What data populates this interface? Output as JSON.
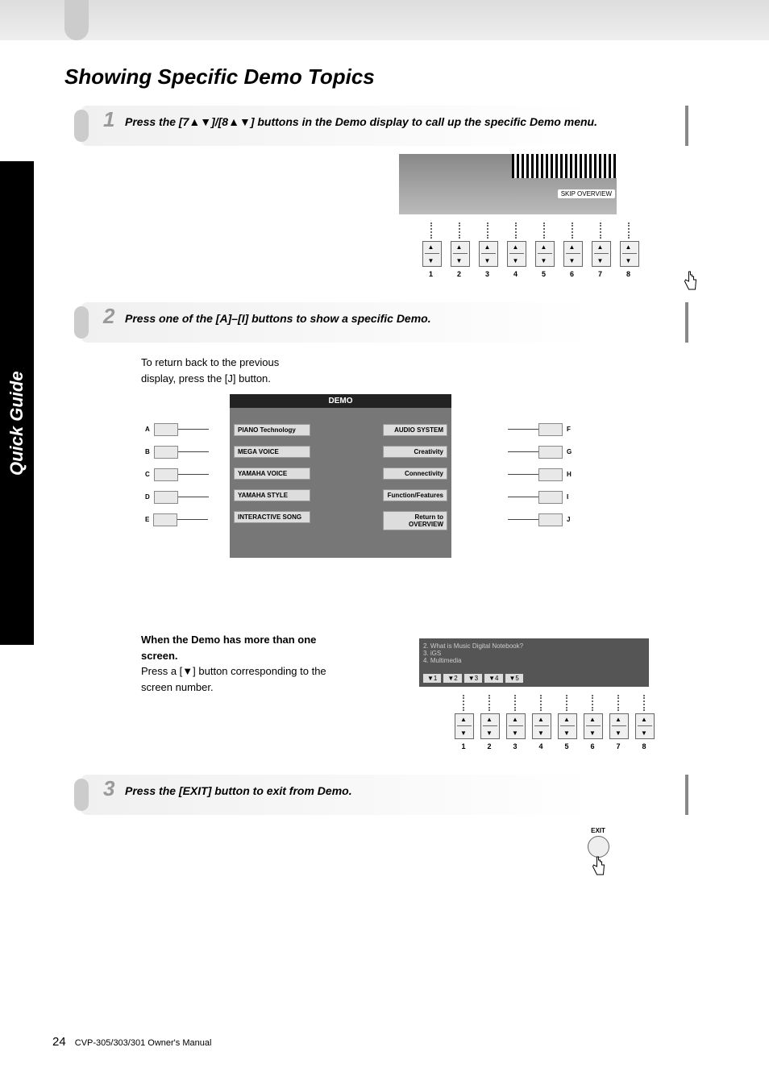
{
  "side_tab": "Quick Guide",
  "title": "Showing Specific Demo Topics",
  "step1": {
    "num": "1",
    "text_prefix": "Press the [7",
    "text_mid": "]/[8",
    "text_suffix": "] buttons in the Demo display to call up the specific Demo menu.",
    "skip_overview": "SKIP OVERVIEW",
    "buttons": [
      "1",
      "2",
      "3",
      "4",
      "5",
      "6",
      "7",
      "8"
    ]
  },
  "step2": {
    "num": "2",
    "text": "Press one of the [A]–[I] buttons to show a specific Demo.",
    "sub": "To return back to the previous display, press the [J] button.",
    "lcd_title": "DEMO",
    "left_labels": [
      "A",
      "B",
      "C",
      "D",
      "E"
    ],
    "right_labels": [
      "F",
      "G",
      "H",
      "I",
      "J"
    ],
    "menu_left": [
      "PIANO Technology",
      "MEGA VOICE",
      "YAMAHA VOICE",
      "YAMAHA STYLE",
      "INTERACTIVE SONG"
    ],
    "menu_right": [
      "AUDIO SYSTEM",
      "Creativity",
      "Connectivity",
      "Function/Features",
      "Return to OVERVIEW"
    ]
  },
  "multiscreen": {
    "heading": "When the Demo has more than one screen.",
    "sub": "Press a [▼] button corresponding to the screen number.",
    "lcd_lines": [
      "2. What is Music Digital Notebook?",
      "3. iGS",
      "4. Multimedia"
    ],
    "tabs": [
      "▼1",
      "▼2",
      "▼3",
      "▼4",
      "▼5"
    ],
    "buttons": [
      "1",
      "2",
      "3",
      "4",
      "5",
      "6",
      "7",
      "8"
    ]
  },
  "step3": {
    "num": "3",
    "text": "Press the [EXIT] button to exit from Demo.",
    "exit_label": "EXIT"
  },
  "footer": {
    "page": "24",
    "text": "CVP-305/303/301 Owner's Manual"
  }
}
